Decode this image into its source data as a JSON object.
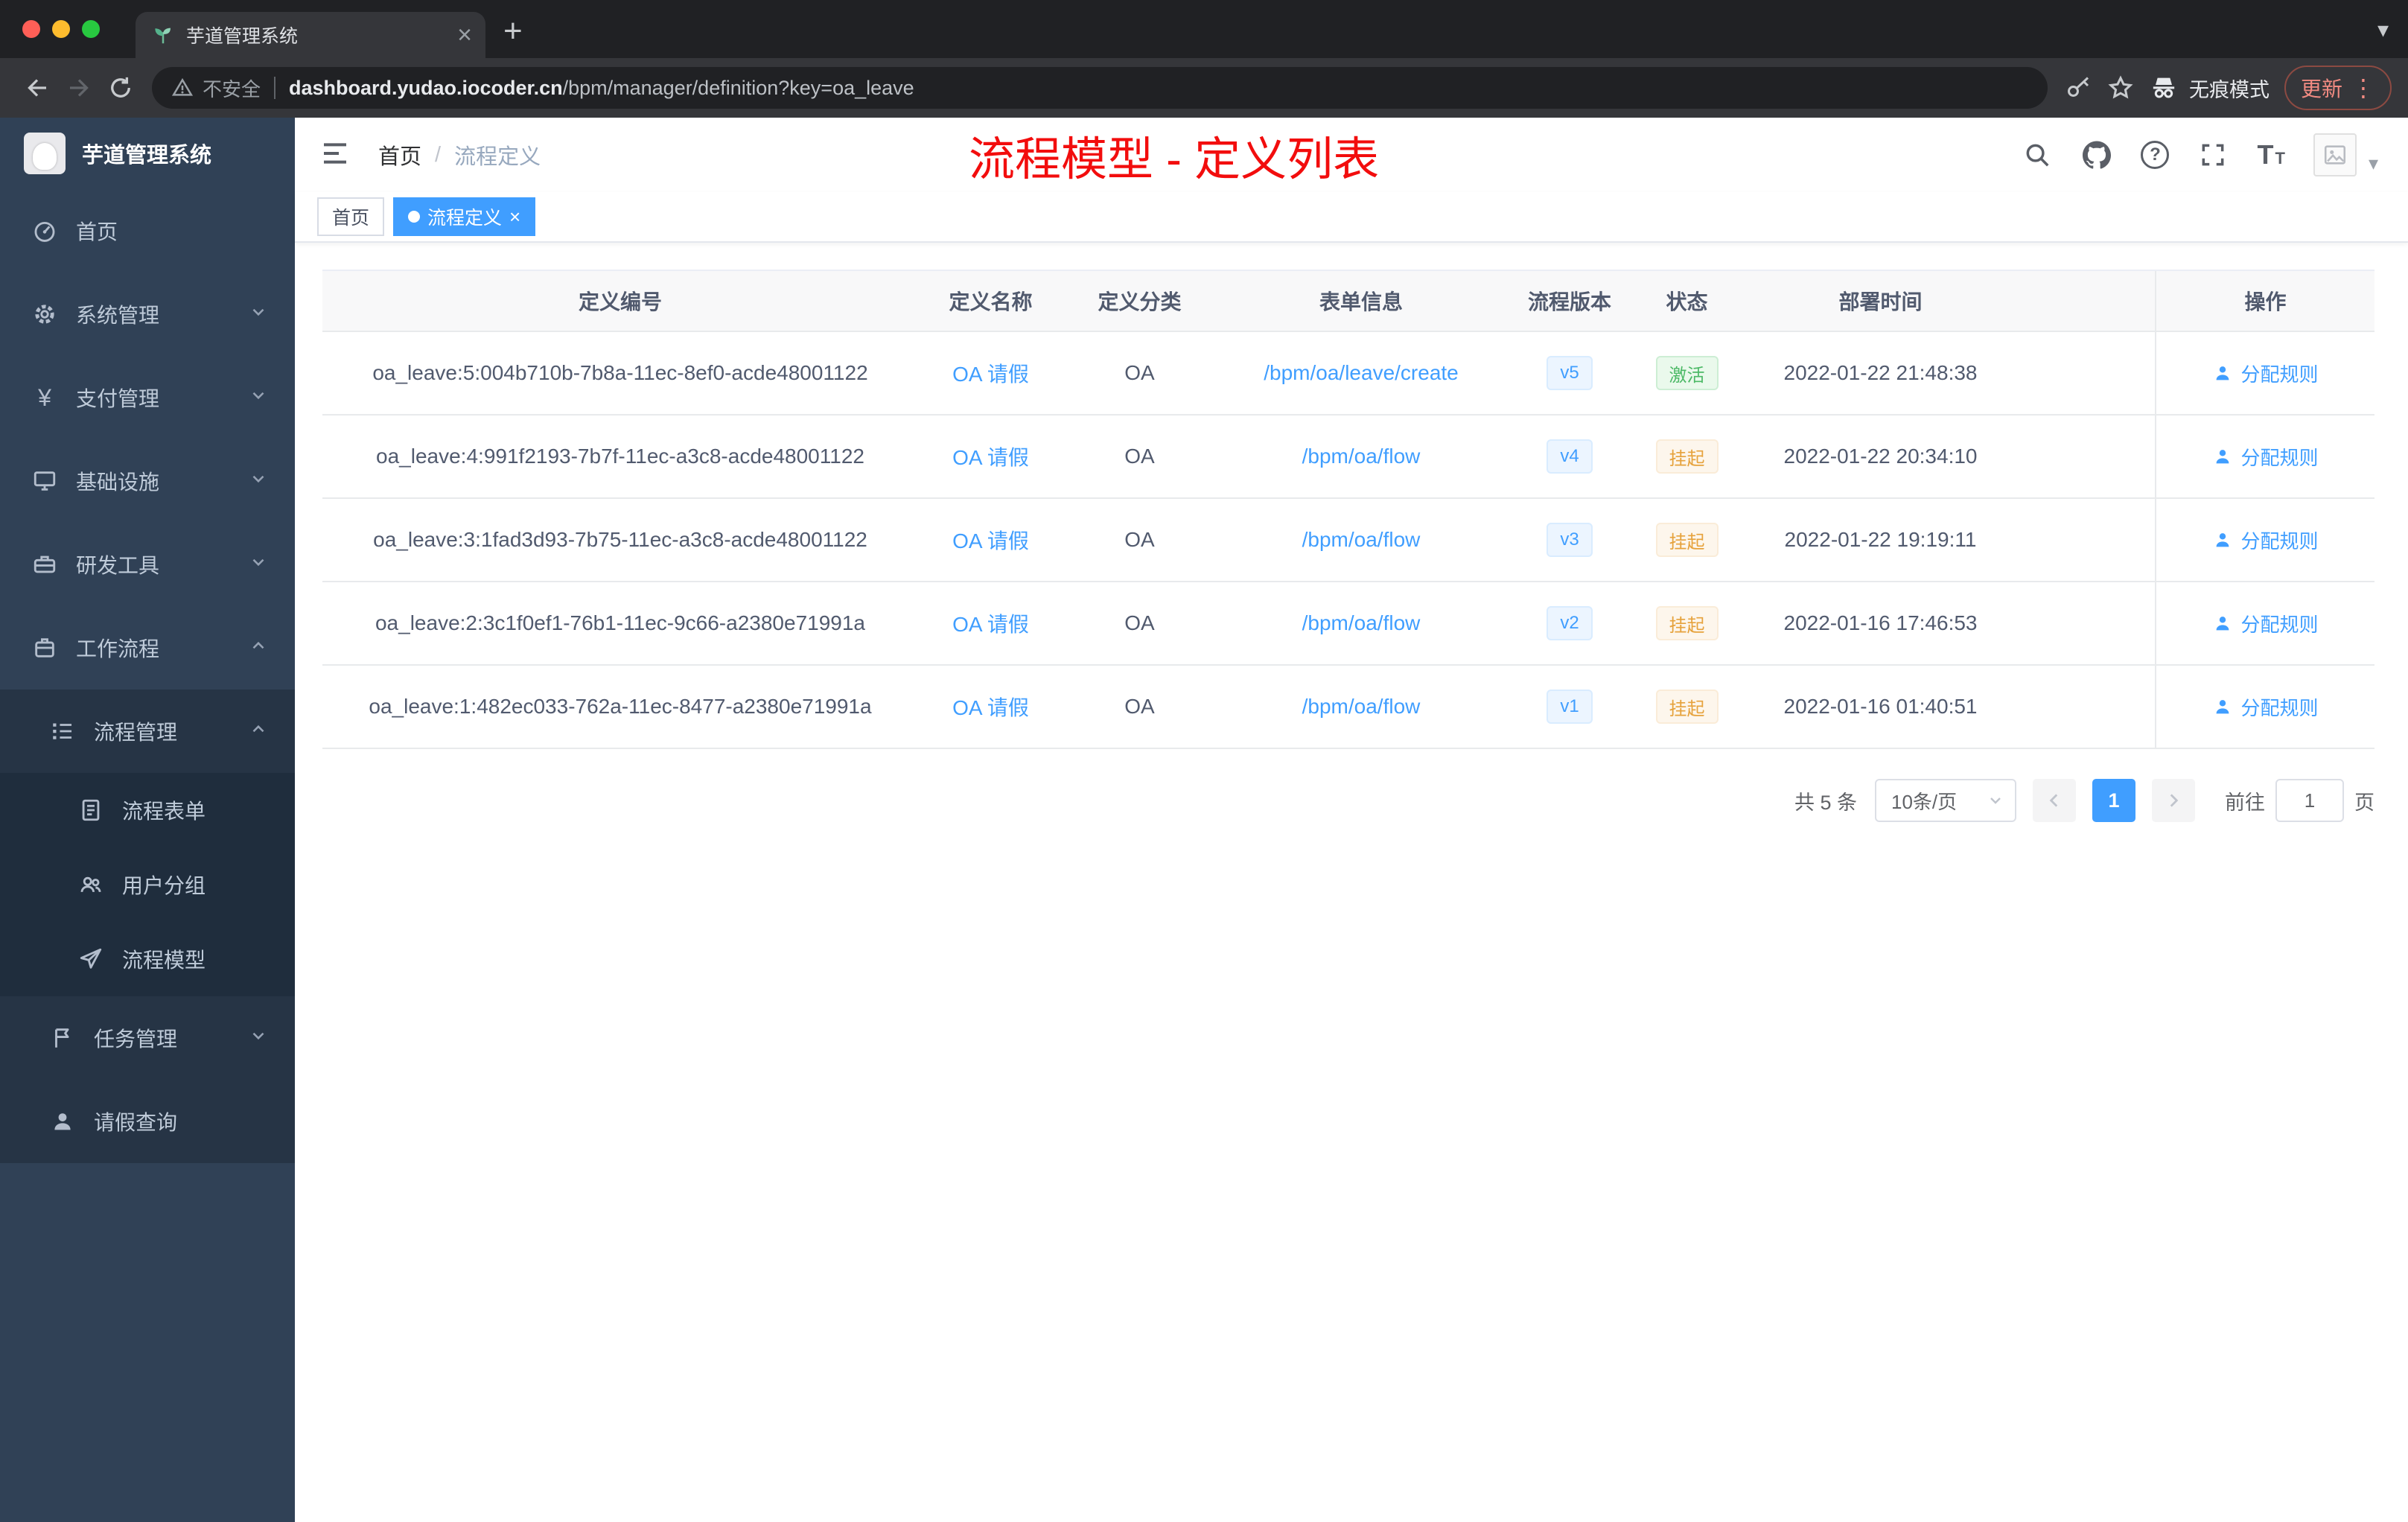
{
  "browser": {
    "tab_title": "芋道管理系统",
    "security_label": "不安全",
    "url_domain": "dashboard.yudao.iocoder.cn",
    "url_path": "/bpm/manager/definition?key=oa_leave",
    "incognito_label": "无痕模式",
    "update_label": "更新"
  },
  "icons": {
    "close": "×",
    "plus": "+",
    "dots": "⋮",
    "caret_down": "▾",
    "question": "?",
    "yen": "¥",
    "letter_t_big": "T",
    "letter_t_small": "T"
  },
  "sidebar": {
    "logo_title": "芋道管理系统",
    "items": [
      {
        "label": "首页"
      },
      {
        "label": "系统管理"
      },
      {
        "label": "支付管理"
      },
      {
        "label": "基础设施"
      },
      {
        "label": "研发工具"
      },
      {
        "label": "工作流程",
        "children": [
          {
            "label": "流程管理",
            "children": [
              {
                "label": "流程表单"
              },
              {
                "label": "用户分组"
              },
              {
                "label": "流程模型"
              }
            ]
          },
          {
            "label": "任务管理"
          },
          {
            "label": "请假查询"
          }
        ]
      }
    ]
  },
  "navbar": {
    "breadcrumb": [
      "首页",
      "流程定义"
    ],
    "breadcrumb_separator": "/",
    "annotation": "流程模型 - 定义列表"
  },
  "tags": [
    {
      "label": "首页"
    },
    {
      "label": "流程定义"
    }
  ],
  "table": {
    "columns": [
      "定义编号",
      "定义名称",
      "定义分类",
      "表单信息",
      "流程版本",
      "状态",
      "部署时间",
      "操作"
    ],
    "rows": [
      {
        "id": "oa_leave:5:004b710b-7b8a-11ec-8ef0-acde48001122",
        "name": "OA 请假",
        "category": "OA",
        "form": "/bpm/oa/leave/create",
        "version": "v5",
        "status": "激活",
        "time": "2022-01-22 21:48:38",
        "action": "分配规则"
      },
      {
        "id": "oa_leave:4:991f2193-7b7f-11ec-a3c8-acde48001122",
        "name": "OA 请假",
        "category": "OA",
        "form": "/bpm/oa/flow",
        "version": "v4",
        "status": "挂起",
        "time": "2022-01-22 20:34:10",
        "action": "分配规则"
      },
      {
        "id": "oa_leave:3:1fad3d93-7b75-11ec-a3c8-acde48001122",
        "name": "OA 请假",
        "category": "OA",
        "form": "/bpm/oa/flow",
        "version": "v3",
        "status": "挂起",
        "time": "2022-01-22 19:19:11",
        "action": "分配规则"
      },
      {
        "id": "oa_leave:2:3c1f0ef1-76b1-11ec-9c66-a2380e71991a",
        "name": "OA 请假",
        "category": "OA",
        "form": "/bpm/oa/flow",
        "version": "v2",
        "status": "挂起",
        "time": "2022-01-16 17:46:53",
        "action": "分配规则"
      },
      {
        "id": "oa_leave:1:482ec033-762a-11ec-8477-a2380e71991a",
        "name": "OA 请假",
        "category": "OA",
        "form": "/bpm/oa/flow",
        "version": "v1",
        "status": "挂起",
        "time": "2022-01-16 01:40:51",
        "action": "分配规则"
      }
    ]
  },
  "pagination": {
    "total": "共 5 条",
    "page_size": "10条/页",
    "current_page": "1",
    "goto_label": "前往",
    "goto_value": "1",
    "goto_unit": "页"
  },
  "colors": {
    "accent": "#409eff",
    "success": "#4cb966",
    "warning": "#e6a23c",
    "annotation_red": "#f20d0d",
    "sidebar_bg": "#304156"
  }
}
